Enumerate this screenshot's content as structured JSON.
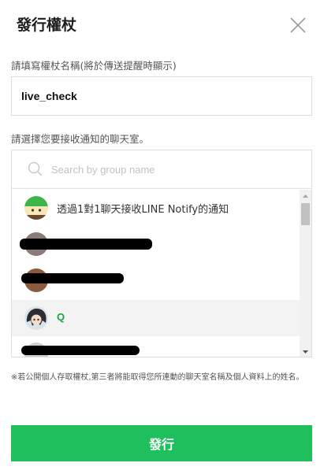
{
  "dialog": {
    "title": "發行權杖",
    "close_icon": "close-icon"
  },
  "token_name": {
    "label": "請填寫權杖名稱(將於傳送提醒時顯示)",
    "value": "live_check"
  },
  "chatroom": {
    "label": "請選擇您要接收通知的聊天室。",
    "search_placeholder": "Search by group name",
    "items": [
      {
        "label": "透過1對1聊天接收LINE Notify的通知",
        "avatar": "line-notify-avatar",
        "selected": false
      },
      {
        "label": "",
        "avatar": "redacted-avatar",
        "selected": false,
        "redacted": true
      },
      {
        "label": "",
        "avatar": "redacted-avatar",
        "selected": false,
        "redacted": true
      },
      {
        "label": "Q",
        "avatar": "group-q-avatar",
        "selected": true
      },
      {
        "label": "",
        "avatar": "redacted-avatar",
        "selected": false,
        "redacted": true
      }
    ]
  },
  "notice": "※若公開個人存取權杖,第三者將能取得您所連動的聊天室名稱及個人資料上的姓名。",
  "issue_button": {
    "label": "發行"
  },
  "colors": {
    "accent": "#1fbf5d",
    "selected_row": "#f3f3f3",
    "group_label": "#1aa34a"
  }
}
